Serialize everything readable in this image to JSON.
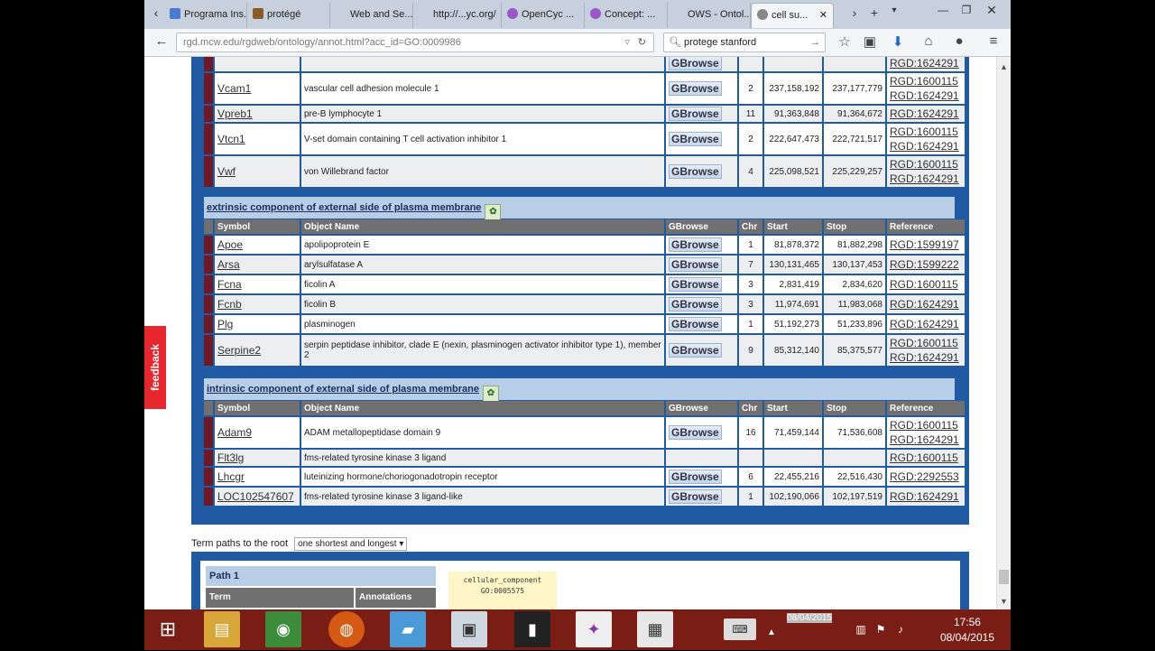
{
  "browser": {
    "tabs": [
      {
        "label": "Programa Ins...",
        "color": "#4a7bd0"
      },
      {
        "label": "protégé",
        "color": "#8a5a2a"
      },
      {
        "label": "Web and Se...",
        "color": "#888888"
      },
      {
        "label": "http://...yc.org/",
        "color": "#888888"
      },
      {
        "label": "OpenCyc ...",
        "color": "#9a55c8"
      },
      {
        "label": "Concept: ...",
        "color": "#9a55c8"
      },
      {
        "label": "OWS - Ontol...",
        "color": "#888888"
      },
      {
        "label": "cell su...",
        "color": "#888888"
      }
    ],
    "url": "rgd.mcw.edu/rgdweb/ontology/annot.html?acc_id=GO:0009986",
    "search": "protege stanford"
  },
  "feedback_label": "feedback",
  "gbrowse_label": "GBrowse",
  "top_rows": [
    {
      "symbol": "",
      "name": "",
      "chr": "",
      "start": "",
      "stop": "",
      "refs": [
        "RGD:1624291"
      ],
      "gbrowse": true
    },
    {
      "symbol": "Vcam1",
      "name": "vascular cell adhesion molecule 1",
      "chr": "2",
      "start": "237,158,192",
      "stop": "237,177,779",
      "refs": [
        "RGD:1600115",
        "RGD:1624291"
      ],
      "gbrowse": true
    },
    {
      "symbol": "Vpreb1",
      "name": "pre-B lymphocyte 1",
      "chr": "11",
      "start": "91,363,848",
      "stop": "91,364,672",
      "refs": [
        "RGD:1624291"
      ],
      "gbrowse": true
    },
    {
      "symbol": "Vtcn1",
      "name": "V-set domain containing T cell activation inhibitor 1",
      "chr": "2",
      "start": "222,647,473",
      "stop": "222,721,517",
      "refs": [
        "RGD:1600115",
        "RGD:1624291"
      ],
      "gbrowse": true
    },
    {
      "symbol": "Vwf",
      "name": "von Willebrand factor",
      "chr": "4",
      "start": "225,098,521",
      "stop": "225,229,257",
      "refs": [
        "RGD:1600115",
        "RGD:1624291"
      ],
      "gbrowse": true
    }
  ],
  "headers": {
    "symbol": "Symbol",
    "name": "Object Name",
    "gbrowse": "GBrowse",
    "chr": "Chr",
    "start": "Start",
    "stop": "Stop",
    "ref": "Reference"
  },
  "section1": {
    "title": "extrinsic component of external side of plasma membrane",
    "rows": [
      {
        "symbol": "Apoe",
        "name": "apolipoprotein E",
        "chr": "1",
        "start": "81,878,372",
        "stop": "81,882,298",
        "refs": [
          "RGD:1599197"
        ],
        "gbrowse": true
      },
      {
        "symbol": "Arsa",
        "name": "arylsulfatase A",
        "chr": "7",
        "start": "130,131,465",
        "stop": "130,137,453",
        "refs": [
          "RGD:1599222"
        ],
        "gbrowse": true
      },
      {
        "symbol": "Fcna",
        "name": "ficolin A",
        "chr": "3",
        "start": "2,831,419",
        "stop": "2,834,620",
        "refs": [
          "RGD:1600115"
        ],
        "gbrowse": true
      },
      {
        "symbol": "Fcnb",
        "name": "ficolin B",
        "chr": "3",
        "start": "11,974,691",
        "stop": "11,983,068",
        "refs": [
          "RGD:1624291"
        ],
        "gbrowse": true
      },
      {
        "symbol": "Plg",
        "name": "plasminogen",
        "chr": "1",
        "start": "51,192,273",
        "stop": "51,233,896",
        "refs": [
          "RGD:1624291"
        ],
        "gbrowse": true
      },
      {
        "symbol": "Serpine2",
        "name": "serpin peptidase inhibitor, clade E (nexin, plasminogen activator inhibitor type 1), member 2",
        "chr": "9",
        "start": "85,312,140",
        "stop": "85,375,577",
        "refs": [
          "RGD:1600115",
          "RGD:1624291"
        ],
        "gbrowse": true
      }
    ]
  },
  "section2": {
    "title": "intrinsic component of external side of plasma membrane",
    "rows": [
      {
        "symbol": "Adam9",
        "name": "ADAM metallopeptidase domain 9",
        "chr": "16",
        "start": "71,459,144",
        "stop": "71,536,608",
        "refs": [
          "RGD:1600115",
          "RGD:1624291"
        ],
        "gbrowse": true
      },
      {
        "symbol": "Flt3lg",
        "name": "fms-related tyrosine kinase 3 ligand",
        "chr": "",
        "start": "",
        "stop": "",
        "refs": [
          "RGD:1600115"
        ],
        "gbrowse": false
      },
      {
        "symbol": "Lhcgr",
        "name": "luteinizing hormone/choriogonadotropin receptor",
        "chr": "6",
        "start": "22,455,216",
        "stop": "22,516,430",
        "refs": [
          "RGD:2292553"
        ],
        "gbrowse": true
      },
      {
        "symbol": "LOC102547607",
        "name": "fms-related tyrosine kinase 3 ligand-like",
        "chr": "1",
        "start": "102,190,066",
        "stop": "102,197,519",
        "refs": [
          "RGD:1624291"
        ],
        "gbrowse": true
      }
    ]
  },
  "term_paths": {
    "label": "Term paths to the root",
    "select_value": "one shortest and longest",
    "path_title": "Path 1",
    "col_term": "Term",
    "col_annotations": "Annotations",
    "node_name": "cellular_component",
    "node_id": "GO:0005575"
  },
  "taskbar": {
    "time": "17:56",
    "date": "08/04/2015",
    "overlay_date": "08/04/2015"
  }
}
